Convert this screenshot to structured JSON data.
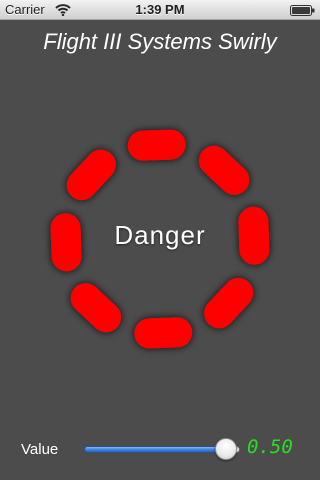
{
  "status_bar": {
    "carrier": "Carrier",
    "time": "1:39 PM",
    "wifi_icon": "wifi-icon",
    "battery_icon": "battery-full-icon"
  },
  "app": {
    "title": "Flight III Systems Swirly"
  },
  "swirly": {
    "label": "Danger",
    "segment_color": "#ff0000",
    "segment_count": 8
  },
  "value_control": {
    "label": "Value",
    "value": 0.5,
    "display": "0.50",
    "slider_position": 0.98,
    "track_fill_color": "#3b7fdc",
    "readout_color": "#27e01f"
  },
  "colors": {
    "background": "#4c4c4c",
    "text": "#ffffff"
  }
}
